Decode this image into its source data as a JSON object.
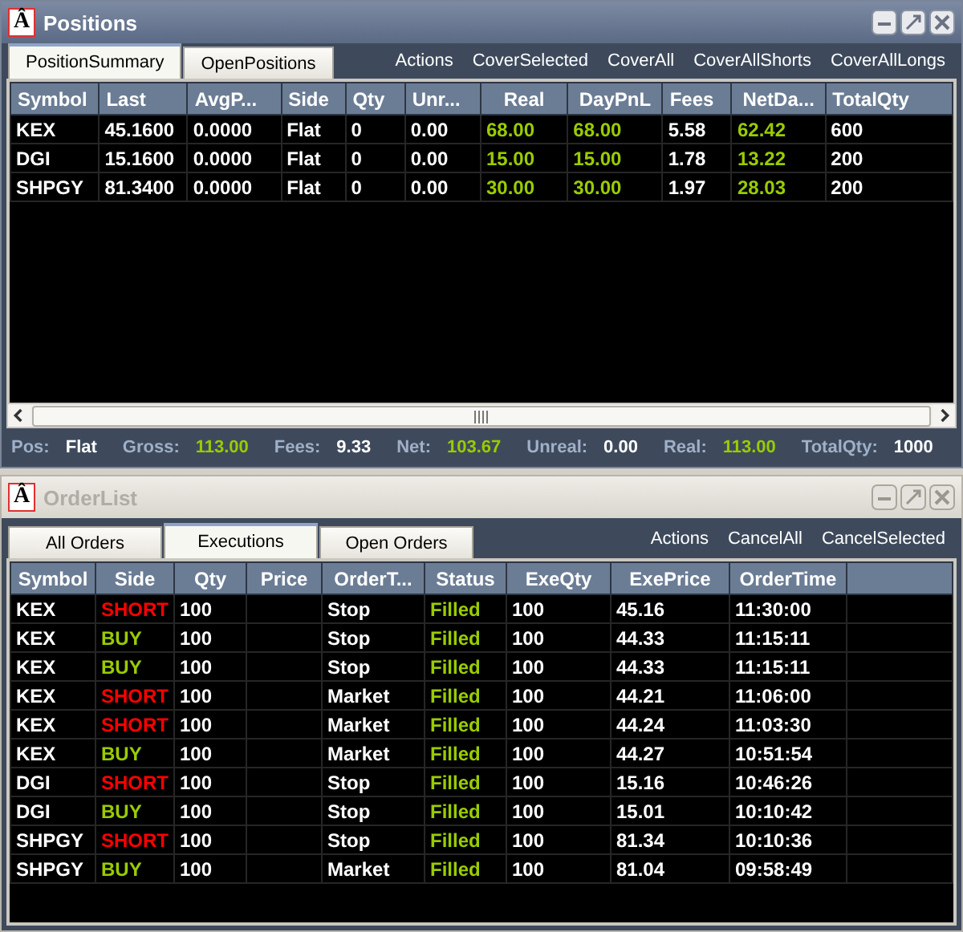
{
  "positions": {
    "logo": "Â",
    "title": "Positions",
    "active": true,
    "tabs": [
      {
        "label": "PositionSummary",
        "selected": true
      },
      {
        "label": "OpenPositions",
        "selected": false
      }
    ],
    "actions": [
      "Actions",
      "CoverSelected",
      "CoverAll",
      "CoverAllShorts",
      "CoverAllLongs"
    ],
    "table": {
      "columns": [
        "Symbol",
        "Last",
        "AvgP...",
        "Side",
        "Qty",
        "Unr...",
        "Real",
        "DayPnL",
        "Fees",
        "NetDa...",
        "TotalQty"
      ],
      "rows": [
        [
          "KEX",
          "45.1600",
          "0.0000",
          "Flat",
          "0",
          "0.00",
          {
            "text": "68.00",
            "color": "#99cc00"
          },
          {
            "text": "68.00",
            "color": "#99cc00"
          },
          "5.58",
          {
            "text": "62.42",
            "color": "#99cc00"
          },
          "600"
        ],
        [
          "DGI",
          "15.1600",
          "0.0000",
          "Flat",
          "0",
          "0.00",
          {
            "text": "15.00",
            "color": "#99cc00"
          },
          {
            "text": "15.00",
            "color": "#99cc00"
          },
          "1.78",
          {
            "text": "13.22",
            "color": "#99cc00"
          },
          "200"
        ],
        [
          "SHPGY",
          "81.3400",
          "0.0000",
          "Flat",
          "0",
          "0.00",
          {
            "text": "30.00",
            "color": "#99cc00"
          },
          {
            "text": "30.00",
            "color": "#99cc00"
          },
          "1.97",
          {
            "text": "28.03",
            "color": "#99cc00"
          },
          "200"
        ]
      ]
    },
    "status_bar": [
      {
        "label": "Pos:",
        "value": "Flat"
      },
      {
        "label": "Gross:",
        "value": "113.00",
        "color": "#99cc00"
      },
      {
        "label": "Fees:",
        "value": "9.33"
      },
      {
        "label": "Net:",
        "value": "103.67",
        "color": "#99cc00"
      },
      {
        "label": "Unreal:",
        "value": "0.00"
      },
      {
        "label": "Real:",
        "value": "113.00",
        "color": "#99cc00"
      },
      {
        "label": "TotalQty:",
        "value": "1000"
      }
    ]
  },
  "orderlist": {
    "logo": "Â",
    "title": "OrderList",
    "active": false,
    "tabs": [
      {
        "label": "All Orders",
        "selected": false
      },
      {
        "label": "Executions",
        "selected": true
      },
      {
        "label": "Open Orders",
        "selected": false
      }
    ],
    "actions": [
      "Actions",
      "CancelAll",
      "CancelSelected"
    ],
    "table": {
      "columns": [
        "Symbol",
        "Side",
        "Qty",
        "Price",
        "OrderT...",
        "Status",
        "ExeQty",
        "ExePrice",
        "OrderTime"
      ],
      "rows": [
        [
          "KEX",
          {
            "text": "SHORT",
            "color": "#ff0000"
          },
          "100",
          "",
          "Stop",
          {
            "text": "Filled",
            "color": "#99cc00"
          },
          "100",
          "45.16",
          "11:30:00"
        ],
        [
          "KEX",
          {
            "text": "BUY",
            "color": "#99cc00"
          },
          "100",
          "",
          "Stop",
          {
            "text": "Filled",
            "color": "#99cc00"
          },
          "100",
          "44.33",
          "11:15:11"
        ],
        [
          "KEX",
          {
            "text": "BUY",
            "color": "#99cc00"
          },
          "100",
          "",
          "Stop",
          {
            "text": "Filled",
            "color": "#99cc00"
          },
          "100",
          "44.33",
          "11:15:11"
        ],
        [
          "KEX",
          {
            "text": "SHORT",
            "color": "#ff0000"
          },
          "100",
          "",
          "Market",
          {
            "text": "Filled",
            "color": "#99cc00"
          },
          "100",
          "44.21",
          "11:06:00"
        ],
        [
          "KEX",
          {
            "text": "SHORT",
            "color": "#ff0000"
          },
          "100",
          "",
          "Market",
          {
            "text": "Filled",
            "color": "#99cc00"
          },
          "100",
          "44.24",
          "11:03:30"
        ],
        [
          "KEX",
          {
            "text": "BUY",
            "color": "#99cc00"
          },
          "100",
          "",
          "Market",
          {
            "text": "Filled",
            "color": "#99cc00"
          },
          "100",
          "44.27",
          "10:51:54"
        ],
        [
          "DGI",
          {
            "text": "SHORT",
            "color": "#ff0000"
          },
          "100",
          "",
          "Stop",
          {
            "text": "Filled",
            "color": "#99cc00"
          },
          "100",
          "15.16",
          "10:46:26"
        ],
        [
          "DGI",
          {
            "text": "BUY",
            "color": "#99cc00"
          },
          "100",
          "",
          "Stop",
          {
            "text": "Filled",
            "color": "#99cc00"
          },
          "100",
          "15.01",
          "10:10:42"
        ],
        [
          "SHPGY",
          {
            "text": "SHORT",
            "color": "#ff0000"
          },
          "100",
          "",
          "Stop",
          {
            "text": "Filled",
            "color": "#99cc00"
          },
          "100",
          "81.34",
          "10:10:36"
        ],
        [
          "SHPGY",
          {
            "text": "BUY",
            "color": "#99cc00"
          },
          "100",
          "",
          "Market",
          {
            "text": "Filled",
            "color": "#99cc00"
          },
          "100",
          "81.04",
          "09:58:49"
        ]
      ]
    }
  }
}
